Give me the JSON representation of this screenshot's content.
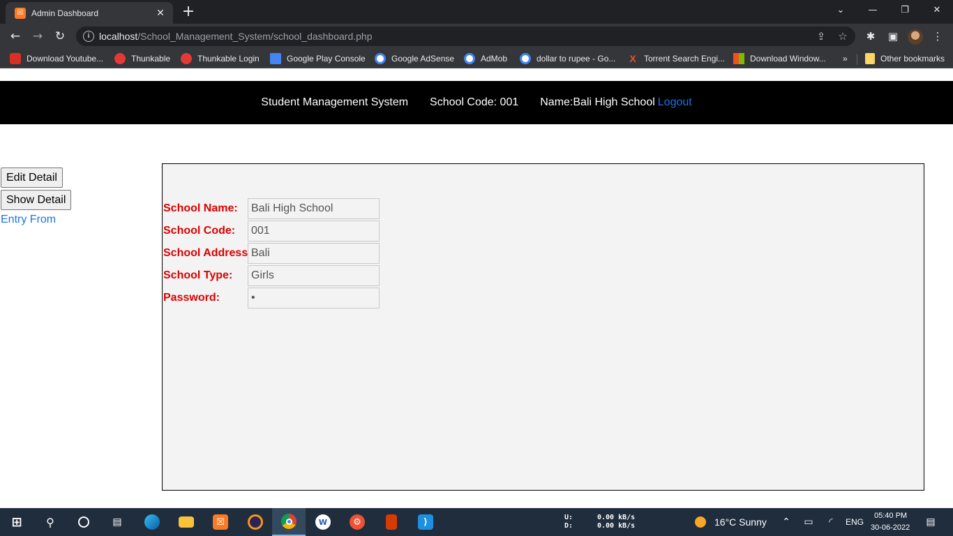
{
  "browser": {
    "tab_title": "Admin Dashboard",
    "url_host": "localhost",
    "url_path": "/School_Management_System/school_dashboard.php",
    "bookmarks": [
      {
        "label": "Download Youtube...",
        "icon": "youtube-download-icon",
        "color": "#d93025"
      },
      {
        "label": "Thunkable",
        "icon": "thunkable-icon",
        "color": "#e53935"
      },
      {
        "label": "Thunkable Login",
        "icon": "thunkable-icon",
        "color": "#e53935"
      },
      {
        "label": "Google Play Console",
        "icon": "play-console-icon",
        "color": "#4285f4"
      },
      {
        "label": "Google AdSense",
        "icon": "google-icon",
        "color": "#ffffff"
      },
      {
        "label": "AdMob",
        "icon": "google-icon",
        "color": "#ffffff"
      },
      {
        "label": "dollar to rupee - Go...",
        "icon": "google-icon",
        "color": "#ffffff"
      },
      {
        "label": "Torrent Search Engi...",
        "icon": "torrent-icon",
        "color": "#e8521e"
      },
      {
        "label": "Download Window...",
        "icon": "windows-icon",
        "color": "#f25022"
      }
    ],
    "overflow_label": "»",
    "other_bookmarks": "Other bookmarks"
  },
  "header": {
    "system_name": "Student Management System",
    "school_code": "School Code: 001",
    "name": "Name:Bali High School",
    "logout": "Logout"
  },
  "sidebar": {
    "edit_button": "Edit Detail",
    "show_button": "Show Detail",
    "entry_link": "Entry From"
  },
  "form": {
    "fields": [
      {
        "label": "School Name:",
        "value": "Bali High School"
      },
      {
        "label": "School Code:",
        "value": "001"
      },
      {
        "label": "School Address:",
        "value": "Bali"
      },
      {
        "label": "School Type:",
        "value": "Girls"
      },
      {
        "label": "Password:",
        "value": "•"
      }
    ]
  },
  "taskbar": {
    "apps": [
      "start-icon",
      "search-icon",
      "cortana-icon",
      "task-view-icon",
      "edge-icon",
      "file-explorer-icon",
      "xampp-icon",
      "eclipse-icon",
      "chrome-icon",
      "word-online-icon",
      "git-icon",
      "office-icon",
      "vscode-icon"
    ],
    "upload_label": "U:",
    "download_label": "D:",
    "upload_speed": "0.00 kB/s",
    "download_speed": "0.00 kB/s",
    "weather": "16°C  Sunny",
    "language": "ENG",
    "time": "05:40 PM",
    "date": "30-06-2022"
  }
}
